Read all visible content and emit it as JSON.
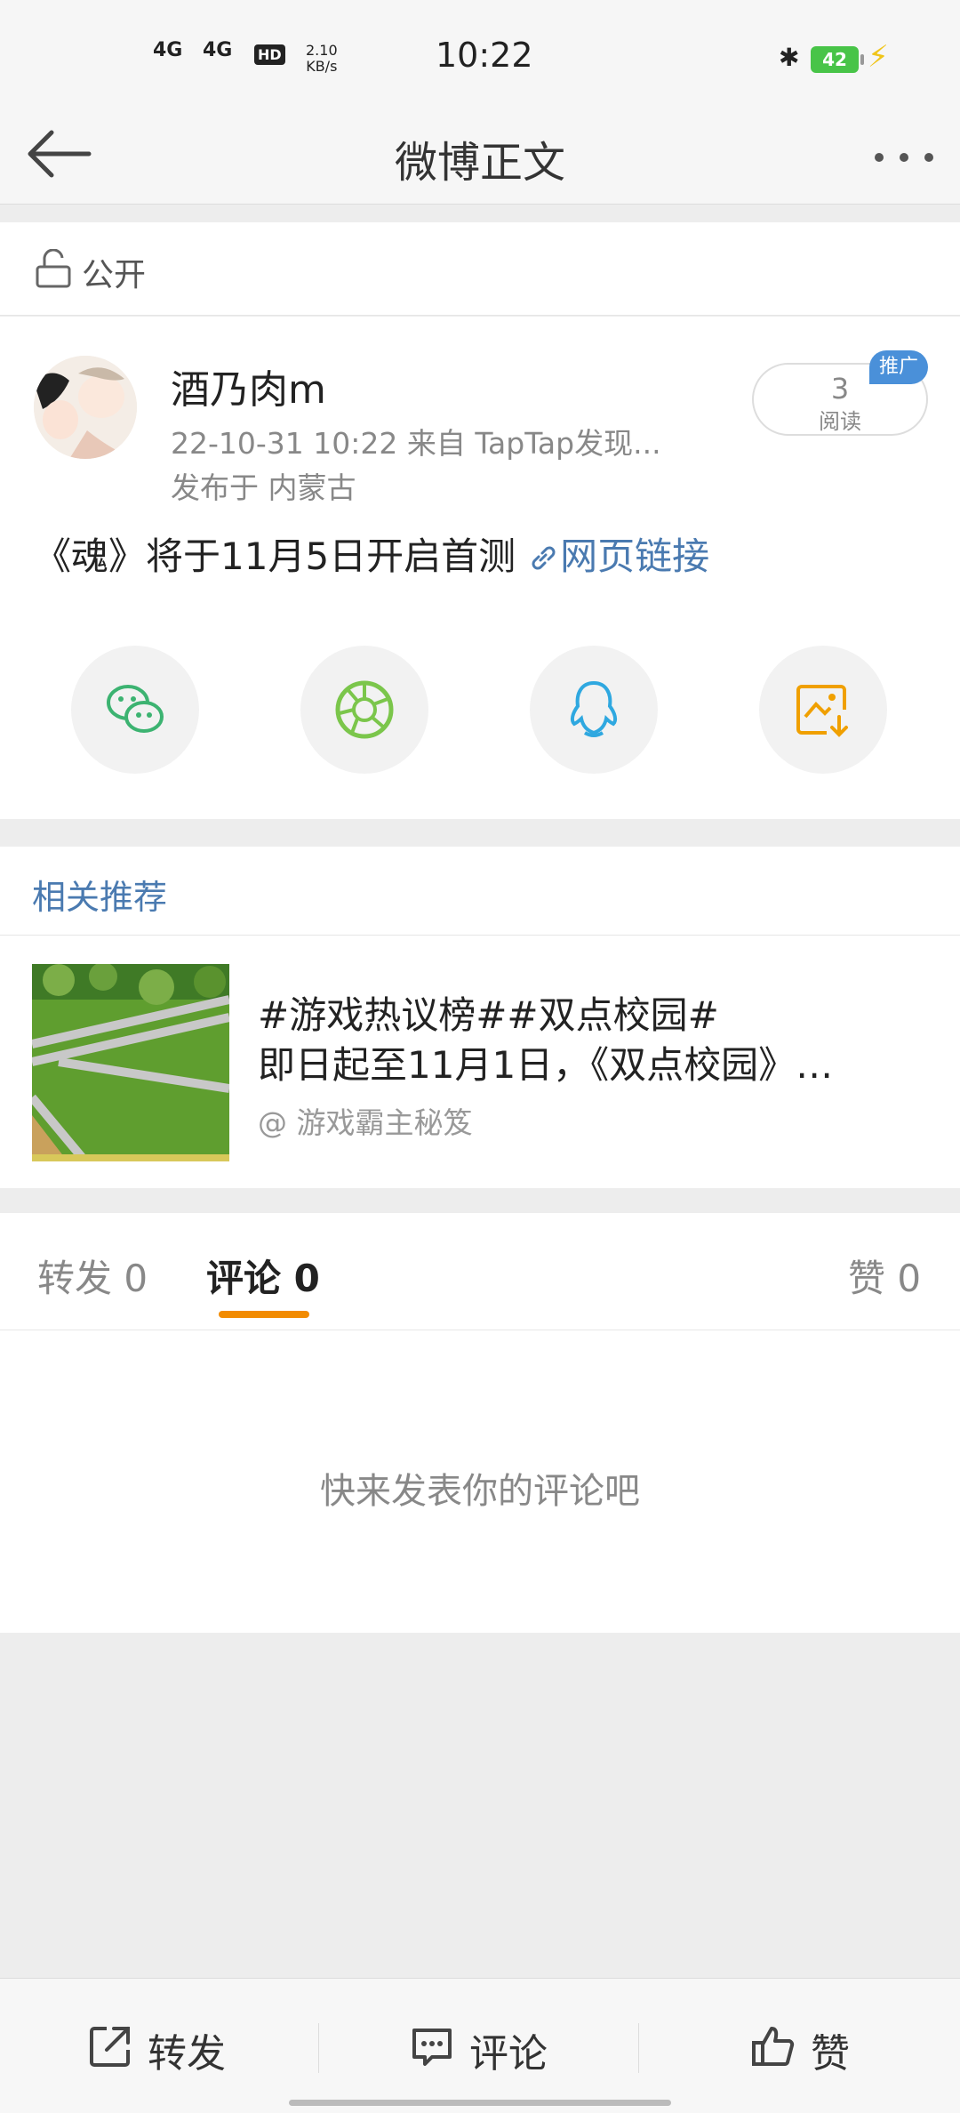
{
  "status_bar": {
    "time": "10:22",
    "signal1": "4G",
    "signal2": "4G",
    "hd_label": "HD",
    "net_speed_value": "2.10",
    "net_speed_unit": "KB/s",
    "battery": "42"
  },
  "nav": {
    "title": "微博正文"
  },
  "visibility": {
    "label": "公开"
  },
  "post": {
    "username": "酒乃肉m",
    "meta": "22-10-31 10:22   来自 TapTap发现...",
    "location": "发布于 内蒙古",
    "promo_tag": "推广",
    "read_count": "3",
    "read_label": "阅读",
    "text": "《魂》将于11月5日开启首测",
    "link_text": "网页链接"
  },
  "share": {
    "icons": [
      "wechat-icon",
      "moments-icon",
      "qq-icon",
      "save-image-icon"
    ]
  },
  "related": {
    "title": "相关推荐",
    "item": {
      "line1": "#游戏热议榜##双点校园#",
      "line2": "即日起至11月1日，《双点校园》…",
      "author": "@ 游戏霸主秘笈"
    }
  },
  "tabs": {
    "repost": "转发 0",
    "comment": "评论 0",
    "like": "赞 0"
  },
  "comments": {
    "empty_text": "快来发表你的评论吧"
  },
  "bottom_bar": {
    "repost": "转发",
    "comment": "评论",
    "like": "赞"
  },
  "colors": {
    "accent": "#f28b00",
    "link": "#4a7ab0",
    "wechat": "#3cb371",
    "moments": "#7bc64b",
    "qq": "#2fa8e0",
    "save": "#f0a000"
  }
}
